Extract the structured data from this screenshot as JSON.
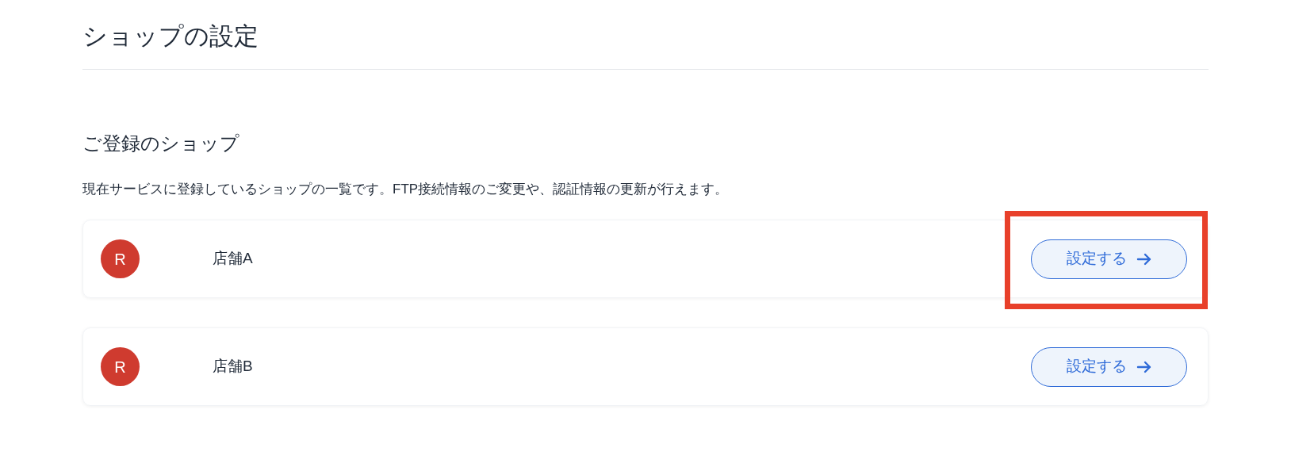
{
  "page_title": "ショップの設定",
  "section": {
    "heading": "ご登録のショップ",
    "description": "現在サービスに登録しているショップの一覧です。FTP接続情報のご変更や、認証情報の更新が行えます。"
  },
  "shops": [
    {
      "avatar": "R",
      "color": "#cf3b2f",
      "name": "店舗A",
      "button": "設定する",
      "highlighted": true
    },
    {
      "avatar": "R",
      "color": "#cf3b2f",
      "name": "店舗B",
      "button": "設定する",
      "highlighted": false
    }
  ]
}
